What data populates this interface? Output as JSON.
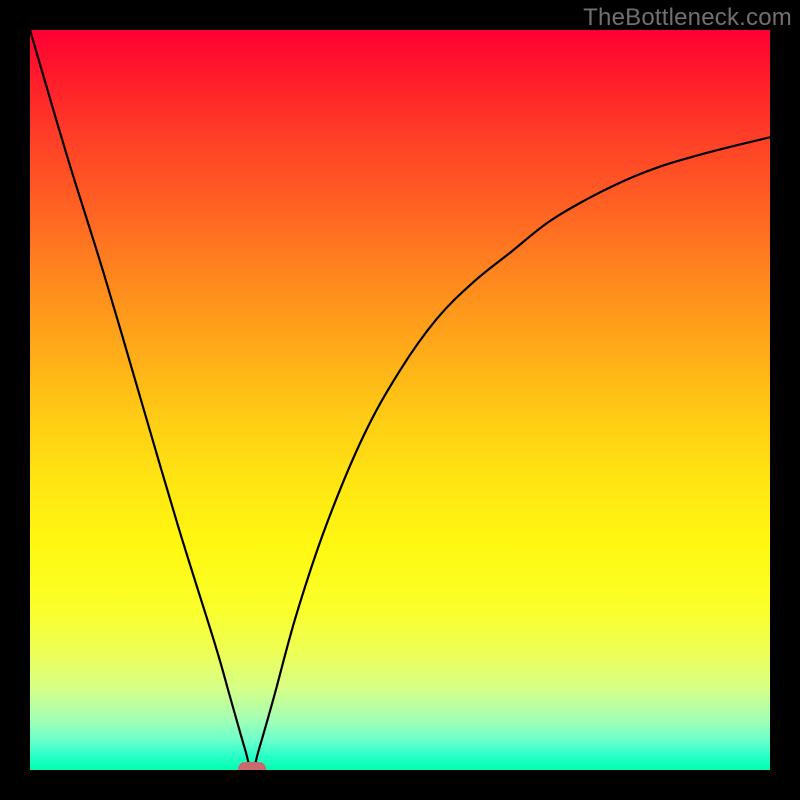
{
  "watermark": "TheBottleneck.com",
  "chart_data": {
    "type": "line",
    "title": "",
    "xlabel": "",
    "ylabel": "",
    "xlim": [
      0,
      100
    ],
    "ylim": [
      0,
      100
    ],
    "grid": false,
    "legend": false,
    "series": [
      {
        "name": "bottleneck-curve",
        "x": [
          0,
          5,
          10,
          15,
          20,
          25,
          27,
          29,
          30,
          31,
          33,
          36,
          40,
          45,
          50,
          55,
          60,
          65,
          70,
          75,
          80,
          85,
          90,
          95,
          100
        ],
        "y": [
          100,
          83,
          67,
          50,
          33,
          17,
          10,
          3,
          0,
          3,
          10,
          21,
          33,
          45,
          54,
          61,
          66,
          70,
          74,
          77,
          79.5,
          81.5,
          83,
          84.3,
          85.5
        ]
      }
    ],
    "annotations": [
      {
        "name": "min-marker",
        "x": 30,
        "y": 0
      }
    ],
    "background_gradient": {
      "top": "#ff0033",
      "mid": "#ffe812",
      "bottom": "#00ffb0"
    },
    "colors": {
      "curve": "#000000",
      "marker": "#c96a6f",
      "frame": "#000000"
    }
  }
}
